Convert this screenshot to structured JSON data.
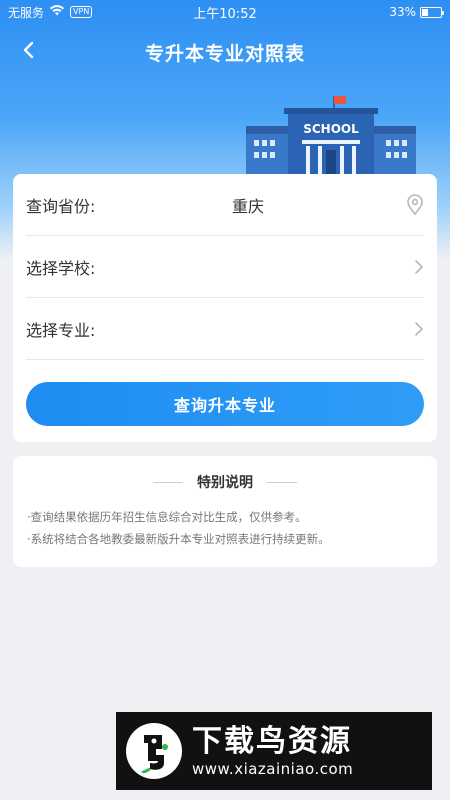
{
  "status_bar": {
    "carrier": "无服务",
    "vpn": "VPN",
    "time": "上午10:52",
    "battery": "33%",
    "battery_level": 0.33
  },
  "nav": {
    "title": "专升本专业对照表",
    "back_icon": "chevron-left-icon"
  },
  "hero": {
    "building_sign": "SCHOOL",
    "flag_color": "#e9573f"
  },
  "form": {
    "province_label": "查询省份:",
    "province_value": "重庆",
    "school_label": "选择学校:",
    "major_label": "选择专业:",
    "submit_label": "查询升本专业"
  },
  "notes": {
    "title": "特别说明",
    "items": [
      "·查询结果依据历年招生信息综合对比生成，仅供参考。",
      "·系统将结合各地教委最新版升本专业对照表进行持续更新。"
    ]
  },
  "watermark": {
    "name": "下载鸟资源",
    "url": "www.xiazainiao.com"
  },
  "colors": {
    "accent": "#1f8cf2",
    "header_top": "#2e8ff3",
    "background": "#eef0f3"
  }
}
